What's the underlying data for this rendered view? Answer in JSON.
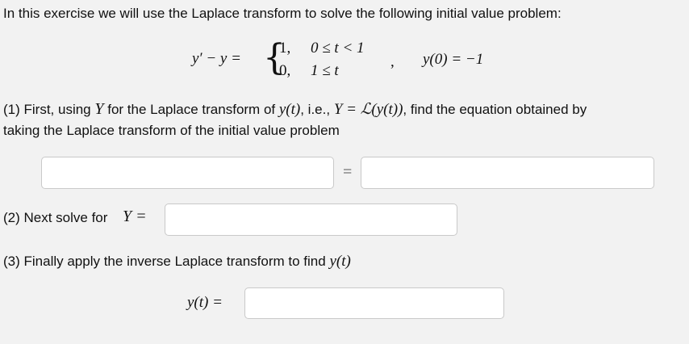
{
  "intro": "In this exercise we will use the Laplace transform to solve the following initial value problem:",
  "ivp": {
    "lhs": "y′ − y =",
    "case1_value": "1,",
    "case1_cond": "0 ≤ t < 1",
    "case2_value": "0,",
    "case2_cond": "1 ≤ t",
    "separator": ",",
    "initial_condition": "y(0) = −1"
  },
  "step1": {
    "text_a": "(1) First, using",
    "Y": "Y",
    "text_b": "for the Laplace transform of",
    "yt": "y(t)",
    "text_c": ", i.e.,",
    "Y_eq": "Y = ℒ(y(t))",
    "text_d": ", find the equation obtained by",
    "line2": "taking the Laplace transform of the initial value problem",
    "equals": "="
  },
  "step2": {
    "label": "(2) Next solve for",
    "Y_eq": "Y ="
  },
  "step3": {
    "label": "(3) Finally apply the inverse Laplace transform to find",
    "yt": "y(t)",
    "answer_label": "y(t) ="
  }
}
